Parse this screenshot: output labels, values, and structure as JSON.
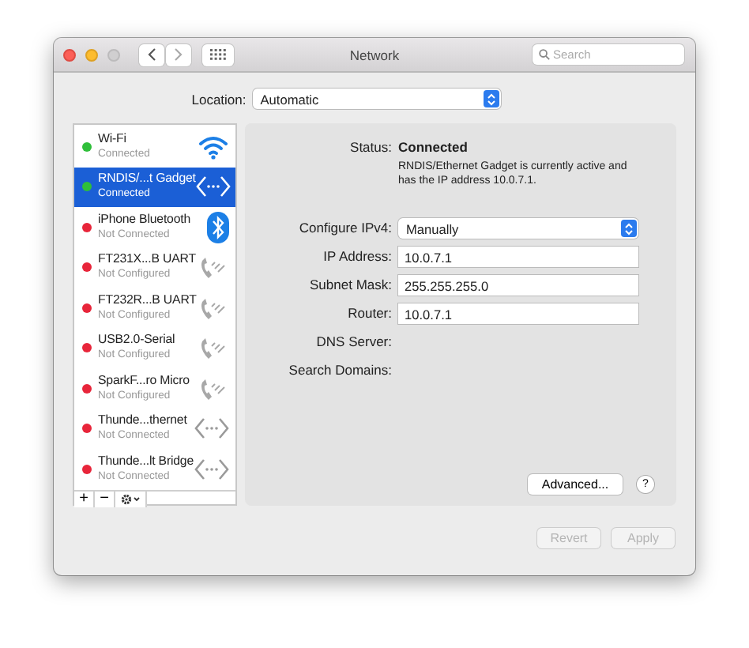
{
  "window": {
    "title": "Network"
  },
  "toolbar": {
    "search": {
      "placeholder": "Search"
    }
  },
  "location": {
    "label": "Location:",
    "value": "Automatic"
  },
  "services": [
    {
      "name": "Wi-Fi",
      "status": "Connected",
      "color": "#2fbf3a",
      "kind": "wifi",
      "selected": false
    },
    {
      "name": "RNDIS/...t Gadget",
      "status": "Connected",
      "color": "#2fbf3a",
      "kind": "ethernet",
      "selected": true
    },
    {
      "name": "iPhone Bluetooth",
      "status": "Not Connected",
      "color": "#e8253a",
      "kind": "bluetooth",
      "selected": false
    },
    {
      "name": "FT231X...B UART",
      "status": "Not Configured",
      "color": "#e8253a",
      "kind": "phone",
      "selected": false
    },
    {
      "name": "FT232R...B UART",
      "status": "Not Configured",
      "color": "#e8253a",
      "kind": "phone",
      "selected": false
    },
    {
      "name": "USB2.0-Serial",
      "status": "Not Configured",
      "color": "#e8253a",
      "kind": "phone",
      "selected": false
    },
    {
      "name": "SparkF...ro Micro",
      "status": "Not Configured",
      "color": "#e8253a",
      "kind": "phone",
      "selected": false
    },
    {
      "name": "Thunde...thernet",
      "status": "Not Connected",
      "color": "#e8253a",
      "kind": "ethernet",
      "selected": false
    },
    {
      "name": "Thunde...lt Bridge",
      "status": "Not Connected",
      "color": "#e8253a",
      "kind": "ethernet",
      "selected": false
    }
  ],
  "list_buttons": [
    "+",
    "−"
  ],
  "detail": {
    "status_label": "Status:",
    "status": "Connected",
    "description": "RNDIS/Ethernet Gadget is currently active and has the IP address 10.0.7.1.",
    "fields": [
      {
        "label": "Configure IPv4:",
        "value": "Manually",
        "kind": "popup"
      },
      {
        "label": "IP Address:",
        "value": "10.0.7.1",
        "kind": "text"
      },
      {
        "label": "Subnet Mask:",
        "value": "255.255.255.0",
        "kind": "text"
      },
      {
        "label": "Router:",
        "value": "10.0.7.1",
        "kind": "text"
      },
      {
        "label": "DNS Server:",
        "kind": "empty"
      },
      {
        "label": "Search Domains:",
        "kind": "empty"
      }
    ],
    "advanced_button": "Advanced...",
    "help_button": "?"
  },
  "footer_buttons": [
    {
      "label": "Revert",
      "disabled": true
    },
    {
      "label": "Apply",
      "disabled": true
    }
  ]
}
